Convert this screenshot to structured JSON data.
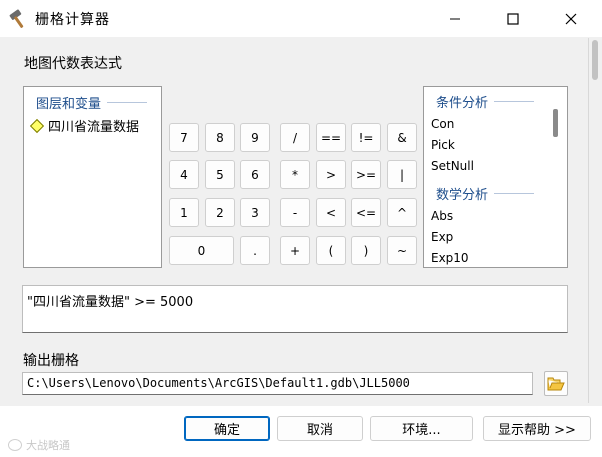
{
  "window": {
    "title": "栅格计算器",
    "icon": "hammer-icon",
    "controls": [
      "minimize-icon",
      "maximize-icon",
      "close-icon"
    ]
  },
  "expression_section": {
    "label": "地图代数表达式"
  },
  "layers_panel": {
    "header": "图层和变量",
    "items": [
      {
        "label": "四川省流量数据",
        "icon": "raster-layer-diamond-icon"
      }
    ]
  },
  "functions_panel": {
    "groups": [
      {
        "header": "条件分析",
        "items": [
          "Con",
          "Pick",
          "SetNull"
        ]
      },
      {
        "header": "数学分析",
        "items": [
          "Abs",
          "Exp",
          "Exp10"
        ]
      }
    ]
  },
  "keypad": {
    "digits": [
      "7",
      "8",
      "9",
      "4",
      "5",
      "6",
      "1",
      "2",
      "3",
      "0",
      "."
    ],
    "operators": [
      "/",
      "==",
      "!=",
      "&",
      "*",
      ">",
      ">=",
      "|",
      "-",
      "<",
      "<=",
      "^",
      "+",
      "(",
      ")",
      "~"
    ]
  },
  "expression": {
    "value": "\"四川省流量数据\" >= 5000"
  },
  "output_section": {
    "label": "输出栅格",
    "path": "C:\\Users\\Lenovo\\Documents\\ArcGIS\\Default1.gdb\\JLL5000",
    "browse_icon": "open-folder-icon"
  },
  "dialog_buttons": {
    "ok": "确定",
    "cancel": "取消",
    "environments": "环境...",
    "show_help": "显示帮助 >>"
  },
  "watermark": {
    "text": "大战略通"
  },
  "colors": {
    "group_header": "#1e4e8c",
    "default_button_border": "#0067c0",
    "layer_icon_fill": "#ffff66"
  }
}
